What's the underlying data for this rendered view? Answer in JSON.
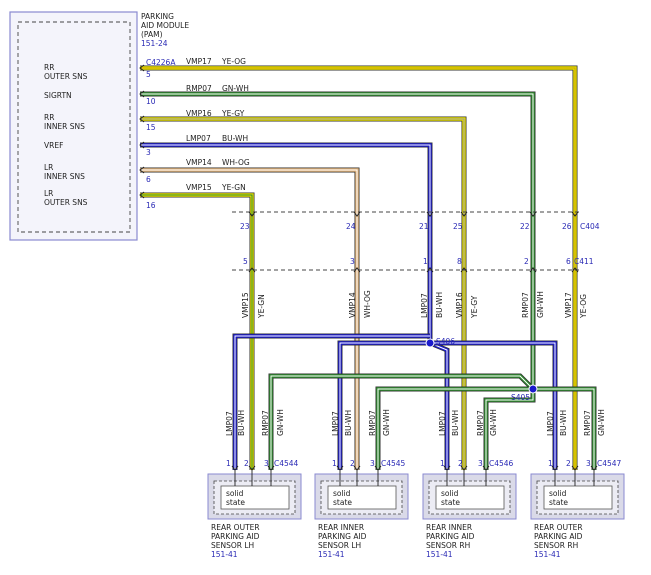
{
  "module": {
    "title_lines": [
      "PARKING",
      "AID MODULE",
      "(PAM)"
    ],
    "ref": "151-24",
    "connector": "C4226A",
    "pins": [
      {
        "label_lines": [
          "RR",
          "OUTER SNS"
        ],
        "pin": "5",
        "circuit": "VMP17",
        "color": "YE-OG"
      },
      {
        "label_lines": [
          "SIGRTN"
        ],
        "pin": "10",
        "circuit": "RMP07",
        "color": "GN-WH"
      },
      {
        "label_lines": [
          "RR",
          "INNER SNS"
        ],
        "pin": "15",
        "circuit": "VMP16",
        "color": "YE-GY"
      },
      {
        "label_lines": [
          "VREF"
        ],
        "pin": "3",
        "circuit": "LMP07",
        "color": "BU-WH"
      },
      {
        "label_lines": [
          "LR",
          "INNER SNS"
        ],
        "pin": "6",
        "circuit": "VMP14",
        "color": "WH-OG"
      },
      {
        "label_lines": [
          "LR",
          "OUTER SNS"
        ],
        "pin": "16",
        "circuit": "VMP15",
        "color": "YE-GN"
      }
    ]
  },
  "inline": {
    "upper_connector": "C404",
    "lower_connector": "C411",
    "upper_pins": [
      "23",
      "24",
      "21",
      "25",
      "22",
      "26"
    ],
    "lower_pins": [
      "5",
      "3",
      "1",
      "8",
      "2",
      "6"
    ],
    "vertical_labels": [
      {
        "circuit": "VMP15",
        "color": "YE-GN"
      },
      {
        "circuit": "VMP14",
        "color": "WH-OG"
      },
      {
        "circuit": "LMP07",
        "color": "BU-WH"
      },
      {
        "circuit": "VMP16",
        "color": "YE-GY"
      },
      {
        "circuit": "RMP07",
        "color": "GN-WH"
      },
      {
        "circuit": "VMP17",
        "color": "YE-OG"
      }
    ]
  },
  "splices": [
    "S406",
    "S405"
  ],
  "sensors": [
    {
      "connector": "C4544",
      "pins": [
        "1",
        "2",
        "3"
      ],
      "state_lines": [
        "solid",
        "state"
      ],
      "name_lines": [
        "REAR OUTER",
        "PARKING AID",
        "SENSOR LH"
      ],
      "ref": "151-41",
      "wires": [
        {
          "circuit": "LMP07",
          "color": "BU-WH"
        },
        {
          "circuit": "RMP07",
          "color": "GN-WH"
        }
      ]
    },
    {
      "connector": "C4545",
      "pins": [
        "1",
        "2",
        "3"
      ],
      "state_lines": [
        "solid",
        "state"
      ],
      "name_lines": [
        "REAR INNER",
        "PARKING AID",
        "SENSOR LH"
      ],
      "ref": "151-41",
      "wires": [
        {
          "circuit": "LMP07",
          "color": "BU-WH"
        },
        {
          "circuit": "RMP07",
          "color": "GN-WH"
        }
      ]
    },
    {
      "connector": "C4546",
      "pins": [
        "1",
        "2",
        "3"
      ],
      "state_lines": [
        "solid",
        "state"
      ],
      "name_lines": [
        "REAR INNER",
        "PARKING AID",
        "SENSOR RH"
      ],
      "ref": "151-41",
      "wires": [
        {
          "circuit": "LMP07",
          "color": "BU-WH"
        },
        {
          "circuit": "RMP07",
          "color": "GN-WH"
        }
      ]
    },
    {
      "connector": "C4547",
      "pins": [
        "1",
        "2",
        "3"
      ],
      "state_lines": [
        "solid",
        "state"
      ],
      "name_lines": [
        "REAR OUTER",
        "PARKING AID",
        "SENSOR RH"
      ],
      "ref": "151-41",
      "wires": [
        {
          "circuit": "LMP07",
          "color": "BU-WH"
        },
        {
          "circuit": "RMP07",
          "color": "GN-WH"
        }
      ]
    }
  ],
  "colors": {
    "yellow": "#e8e000",
    "green": "#2e8b2e",
    "blue": "#1a1acc",
    "tan": "#e0b27a",
    "text_blue": "#2a2ab5",
    "frame": "#8a8ad0"
  }
}
